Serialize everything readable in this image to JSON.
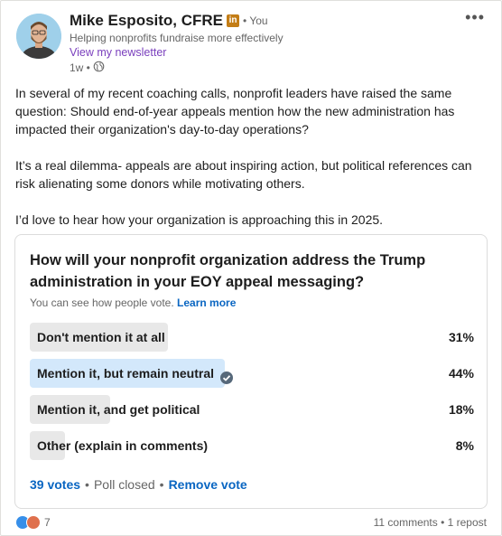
{
  "author": {
    "name": "Mike Esposito, CFRE",
    "badge": "in",
    "you_label": "• You",
    "tagline": "Helping nonprofits fundraise more effectively",
    "newsletter_link": "View my newsletter",
    "time_ago": "1w •"
  },
  "post": {
    "paragraphs": [
      "In several of my recent coaching calls, nonprofit leaders have raised the same question: Should end-of-year appeals mention how the new administration has impacted their organization's day-to-day operations?",
      "It’s a real dilemma- appeals are about inspiring action, but political references can risk alienating some donors while motivating others.",
      "I’d love to hear how your organization is approaching this in 2025."
    ]
  },
  "poll": {
    "question": "How will your nonprofit organization address the Trump administration in your EOY appeal messaging?",
    "visibility_note": "You can see how people vote.",
    "learn_more": "Learn more",
    "options": [
      {
        "label": "Don't mention it at all",
        "percent": "31%",
        "share": 0.31,
        "selected": false
      },
      {
        "label": "Mention it, but remain neutral",
        "percent": "44%",
        "share": 0.44,
        "selected": true
      },
      {
        "label": "Mention it, and get political",
        "percent": "18%",
        "share": 0.18,
        "selected": false
      },
      {
        "label": "Other (explain in comments)",
        "percent": "8%",
        "share": 0.08,
        "selected": false
      }
    ],
    "votes": "39 votes",
    "sep1": "•",
    "status": "Poll closed",
    "sep2": "•",
    "remove_vote": "Remove vote"
  },
  "social": {
    "reaction_count": "7",
    "comments_reposts": "11 comments • 1 repost"
  },
  "colors": {
    "link_blue": "#0a66c2",
    "newsletter_purple": "#7a3fbd",
    "bar_gray": "#e8e8e8",
    "bar_selected": "#d3e8fb"
  }
}
